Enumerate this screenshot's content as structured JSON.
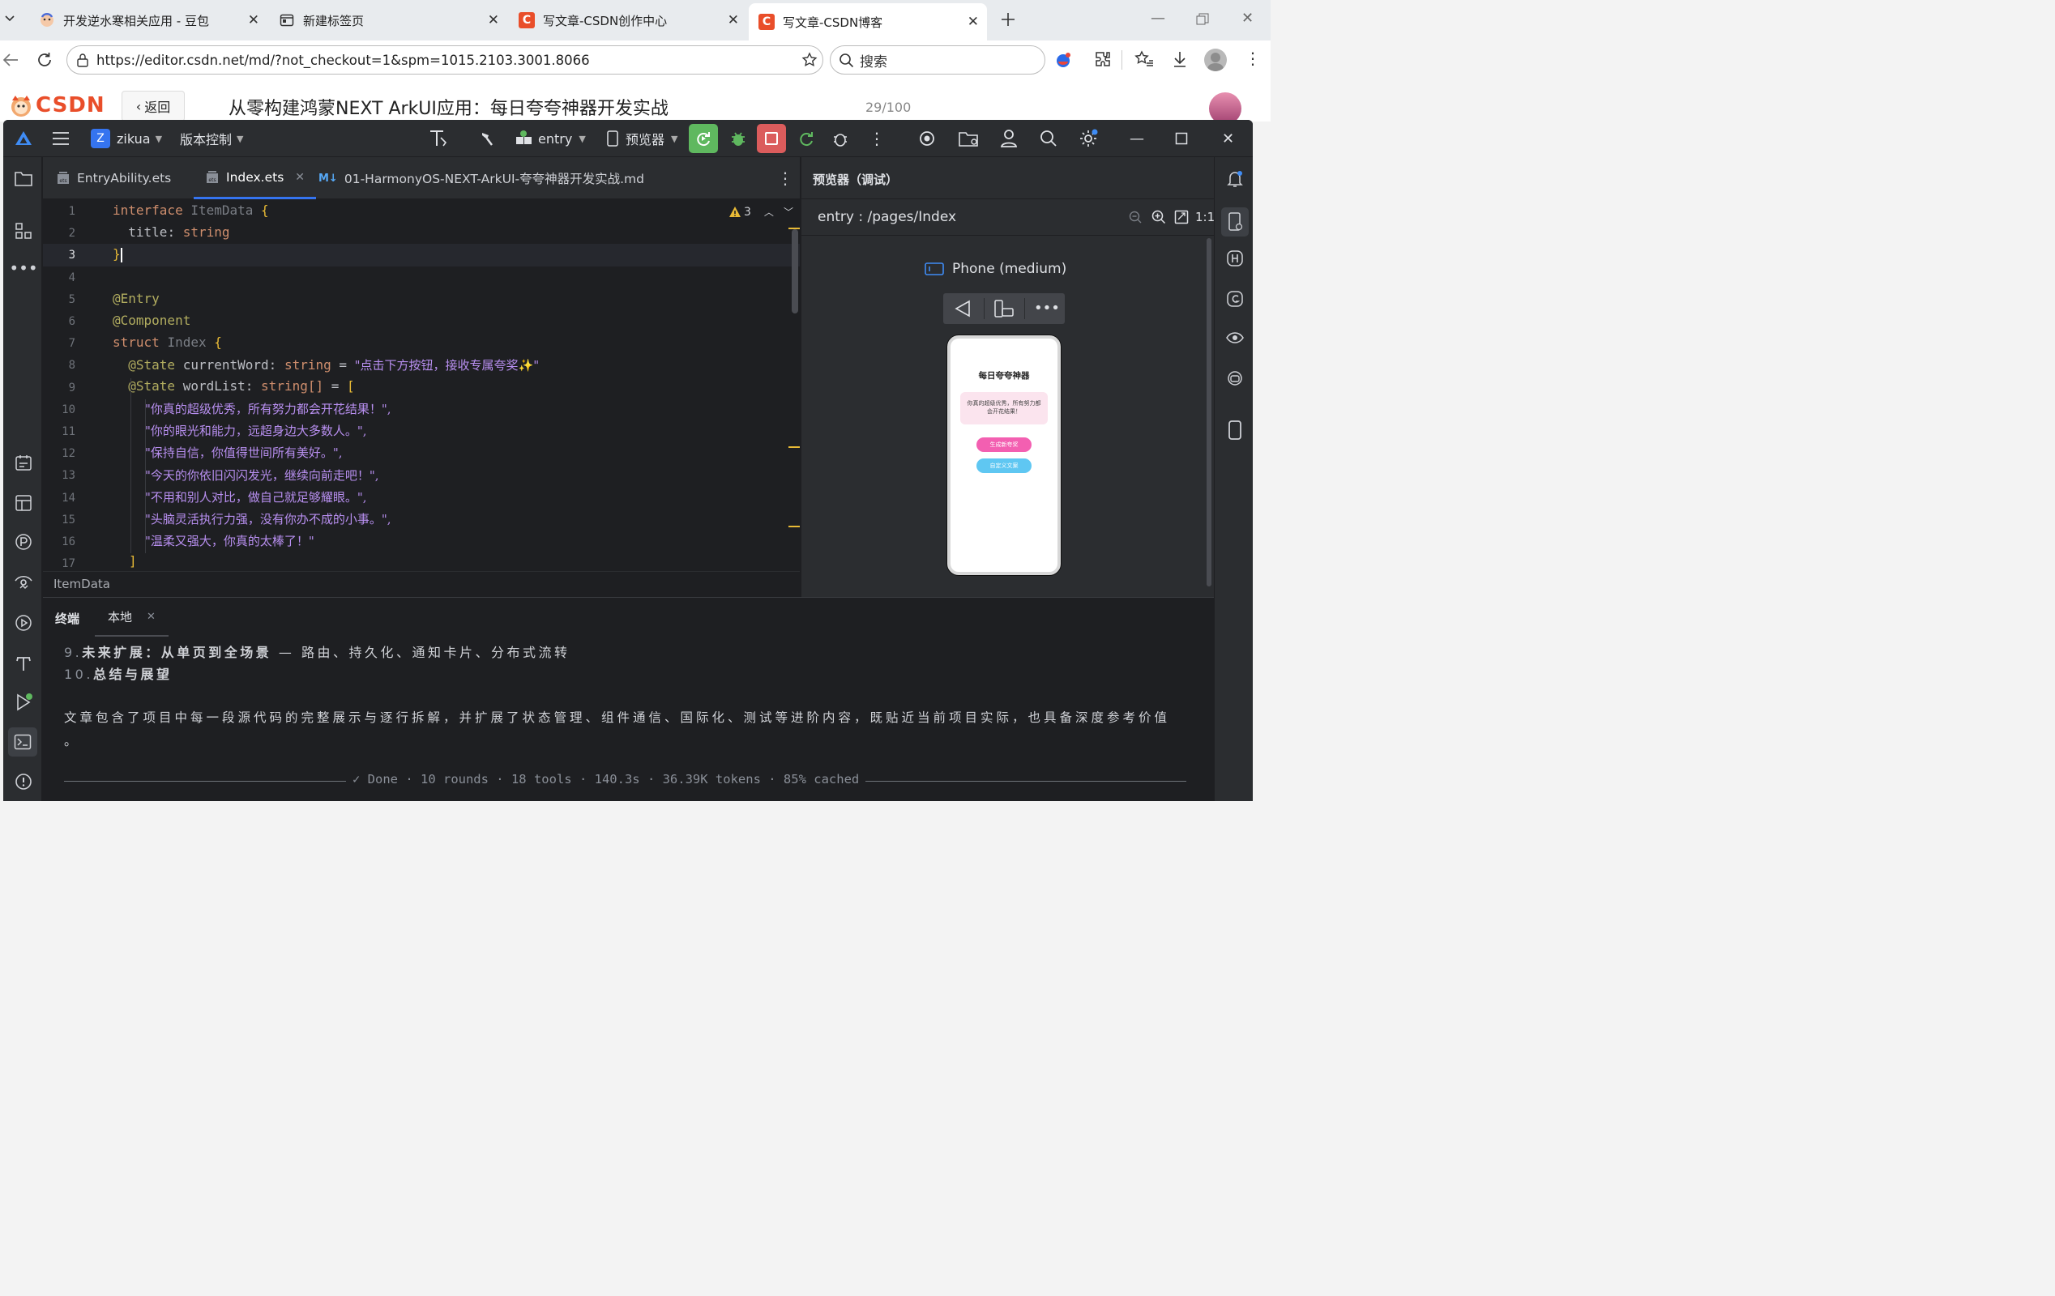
{
  "browser": {
    "tabs": [
      {
        "title": "开发逆水寒相关应用 - 豆包",
        "icon": "doubao-icon",
        "active": false
      },
      {
        "title": "新建标签页",
        "icon": "newtab-icon",
        "active": false
      },
      {
        "title": "写文章-CSDN创作中心",
        "icon": "csdn-icon",
        "active": false
      },
      {
        "title": "写文章-CSDN博客",
        "icon": "csdn-icon",
        "active": true
      }
    ],
    "csdn_letter": "C",
    "url": "https://editor.csdn.net/md/?not_checkout=1&spm=1015.2103.3001.8066",
    "search_placeholder": "搜索"
  },
  "csdn_editor": {
    "logo": "CSDN",
    "back_label": "返回",
    "article_title": "从零构建鸿蒙NEXT ArkUI应用：每日夸夸神器开发实战",
    "word_count": "29/100"
  },
  "ide": {
    "project_letter": "Z",
    "project": "zikua",
    "vcs": "版本控制",
    "run_config": "entry",
    "device": "预览器",
    "tabs": [
      {
        "label": "EntryAbility.ets",
        "active": false,
        "closable": false
      },
      {
        "label": "Index.ets",
        "active": true,
        "closable": true
      },
      {
        "label": "01-HarmonyOS-NEXT-ArkUI-夸夸神器开发实战.md",
        "active": false,
        "closable": false
      }
    ],
    "md_badge": "M↓",
    "warning_count": "3",
    "line_numbers": [
      "1",
      "2",
      "3",
      "4",
      "5",
      "6",
      "7",
      "8",
      "9",
      "10",
      "11",
      "12",
      "13",
      "14",
      "15",
      "16",
      "17"
    ],
    "code": {
      "l1": {
        "kw": "interface",
        "name": "ItemData",
        "brace": "{"
      },
      "l2": {
        "prop": "title",
        "colon": ":",
        "type": "string"
      },
      "l3": {
        "brace": "}"
      },
      "l5": "@Entry",
      "l6": "@Component",
      "l7": {
        "kw": "struct",
        "name": "Index",
        "brace": "{"
      },
      "l8": {
        "ann": "@State",
        "name": "currentWord",
        "colon": ":",
        "type": "string",
        "eq": " = ",
        "value": "\"点击下方按钮，接收专属夸奖✨\""
      },
      "l9": {
        "ann": "@State",
        "name": "wordList",
        "colon": ":",
        "type": "string[]",
        "eq": " = ",
        "open": "["
      },
      "list": [
        "\"你真的超级优秀，所有努力都会开花结果！\",",
        "\"你的眼光和能力，远超身边大多数人。\",",
        "\"保持自信，你值得世间所有美好。\",",
        "\"今天的你依旧闪闪发光，继续向前走吧！\",",
        "\"不用和别人对比，做自己就足够耀眼。\",",
        "\"头脑灵活执行力强，没有你办不成的小事。\",",
        "\"温柔又强大，你真的太棒了！\""
      ],
      "l17": "]"
    },
    "breadcrumb": "ItemData",
    "preview": {
      "title": "预览器（调试）",
      "route": "entry : /pages/Index",
      "ratio": "1:1",
      "device": "Phone (medium)",
      "phone_title": "每日夸夸神器",
      "phone_word": "你真的超级优秀，所有努力都会开花结果！",
      "btn_generate": "生成新夸奖",
      "btn_custom": "自定义文案"
    },
    "terminal": {
      "tab_label": "终端",
      "session": "本地",
      "lines": [
        {
          "num": "9.",
          "bold": "未来扩展：从单页到全场景",
          "rest": " — 路由、持久化、通知卡片、分布式流转"
        },
        {
          "num": "10.",
          "bold": "总结与展望",
          "rest": ""
        }
      ],
      "paragraph": "文章包含了项目中每一段源代码的完整展示与逐行拆解，并扩展了状态管理、组件通信、国际化、测试等进阶内容，既贴近当前项目实际，也具备深度参考价值",
      "paragraph_end": "。",
      "status": "✓ Done · 10 rounds · 18 tools · 140.3s · 36.39K tokens · 85% cached"
    }
  },
  "colors": {
    "ide_bg": "#1e1f22",
    "ide_panel": "#2b2d30",
    "accent_blue": "#3574f0",
    "run_green": "#5fb85f",
    "stop_red": "#db5c5c",
    "csdn_red": "#e94e2a",
    "preview_pink": "#f35fb1",
    "preview_cyan": "#5fc7f2"
  }
}
